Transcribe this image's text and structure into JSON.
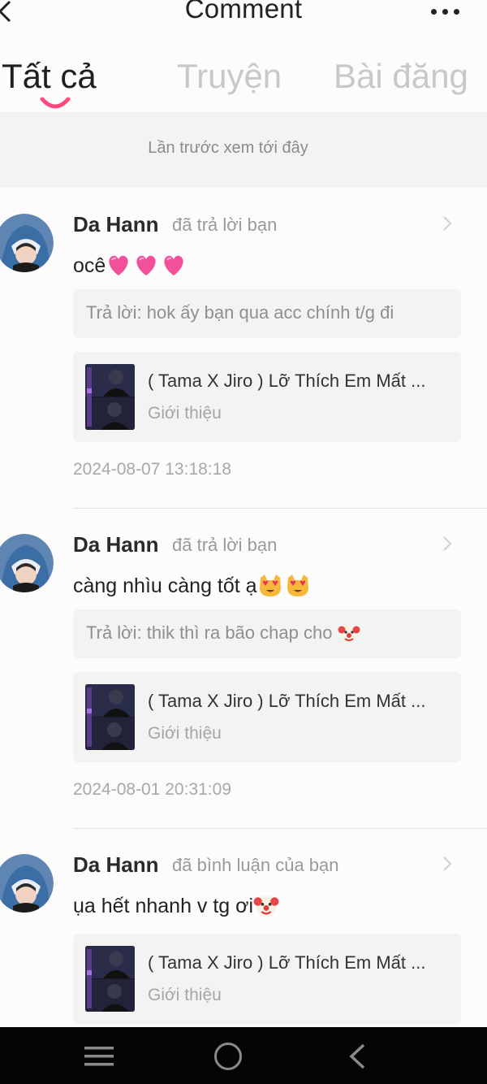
{
  "header": {
    "title": "Comment",
    "back_icon": "chevron-left-icon",
    "more_icon": "more-dots-icon"
  },
  "tabs": [
    {
      "label": "Tất cả",
      "active": true
    },
    {
      "label": "Truyện",
      "active": false
    },
    {
      "label": "Bài đăng",
      "active": false
    }
  ],
  "last_seen": "Lần trước xem tới đây",
  "notifications": [
    {
      "username": "Da Hann",
      "action": "đã trả lời bạn",
      "message": "ocê",
      "message_emoji": "heart",
      "reply": "Trả lời: hok ấy bạn qua acc chính t/g đi",
      "story_title": "( Tama X Jiro ) Lỡ Thích Em Mất ...",
      "story_sub": "Giới thiệu",
      "timestamp": "2024-08-07 13:18:18"
    },
    {
      "username": "Da Hann",
      "action": "đã trả lời bạn",
      "message": "càng nhìu càng tốt ạ",
      "message_emoji": "heart-eyes-cat",
      "reply": "Trả lời: thik thì ra bão chap cho",
      "reply_emoji": "clown",
      "story_title": "( Tama X Jiro ) Lỡ Thích Em Mất ...",
      "story_sub": "Giới thiệu",
      "timestamp": "2024-08-01 20:31:09"
    },
    {
      "username": "Da Hann",
      "action": "đã bình luận của bạn",
      "message": "ụa hết nhanh v tg ơi",
      "message_emoji": "clown",
      "story_title": "( Tama X Jiro ) Lỡ Thích Em Mất ...",
      "story_sub": "Giới thiệu"
    }
  ],
  "colors": {
    "accent": "#ff4a7d",
    "background": "#fdfcfc",
    "card": "#f3f3f3"
  }
}
